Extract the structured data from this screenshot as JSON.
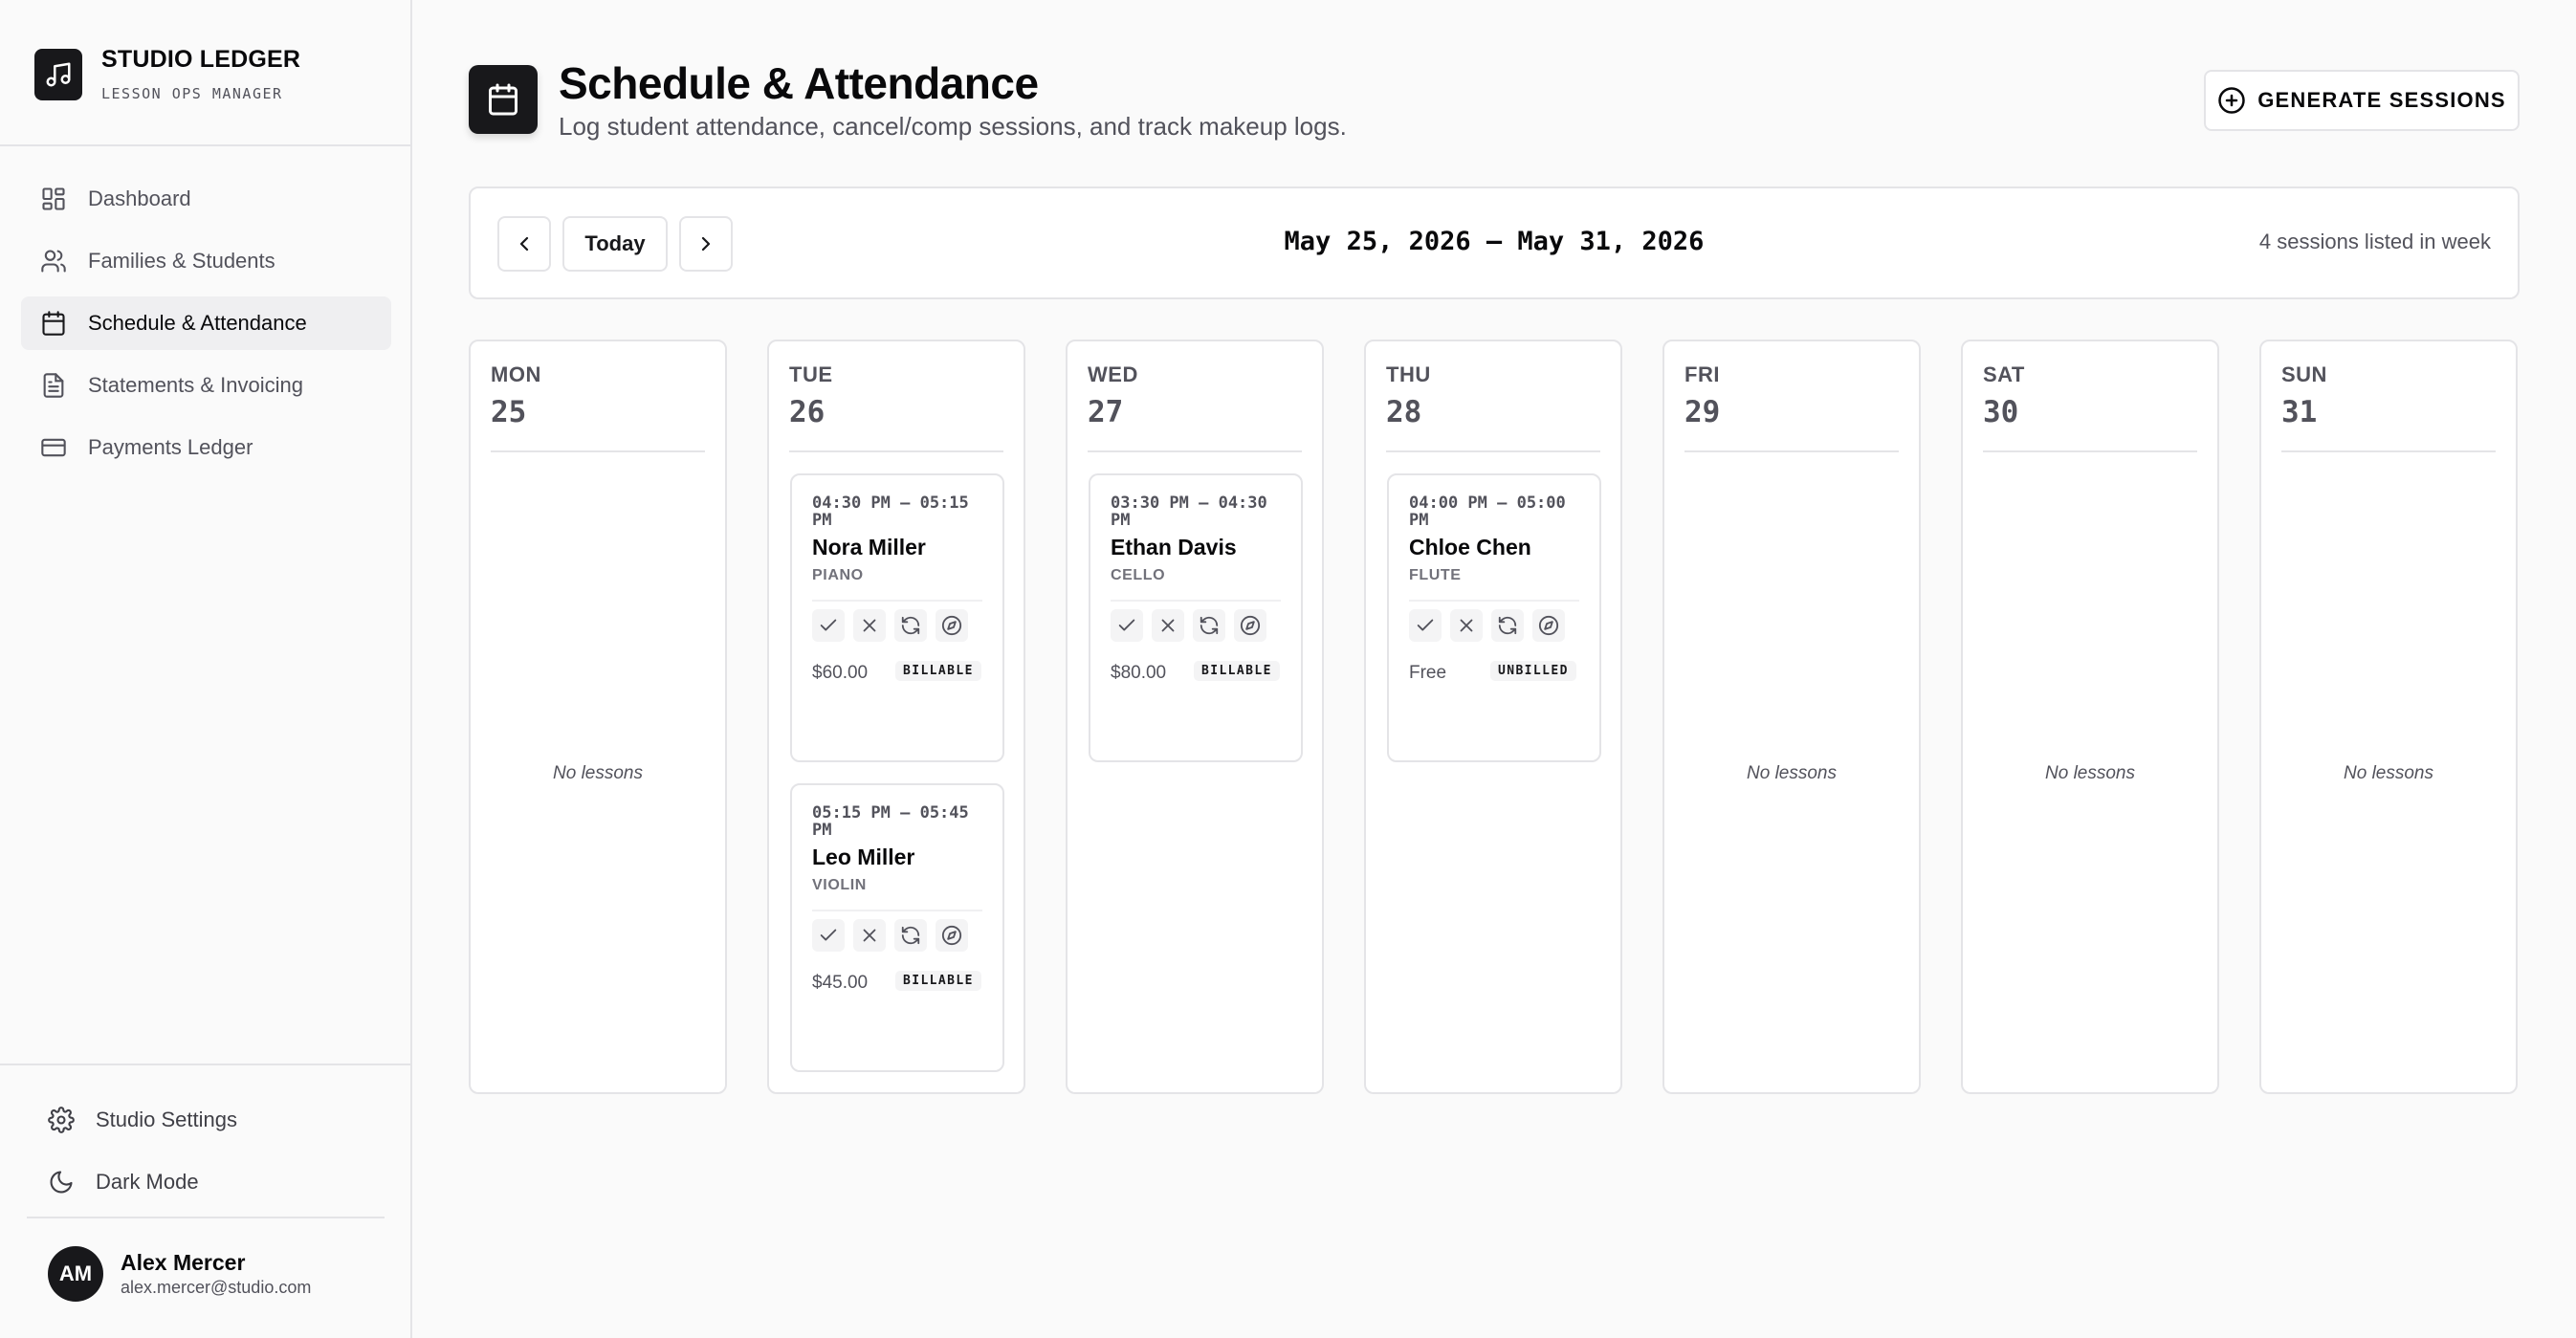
{
  "brand": {
    "title": "STUDIO LEDGER",
    "subtitle": "LESSON OPS MANAGER",
    "logo_icon": "music-note-icon"
  },
  "nav": [
    {
      "label": "Dashboard",
      "icon": "dashboard-icon",
      "active": false
    },
    {
      "label": "Families & Students",
      "icon": "users-icon",
      "active": false
    },
    {
      "label": "Schedule & Attendance",
      "icon": "calendar-icon",
      "active": true
    },
    {
      "label": "Statements & Invoicing",
      "icon": "document-icon",
      "active": false
    },
    {
      "label": "Payments Ledger",
      "icon": "credit-card-icon",
      "active": false
    }
  ],
  "bottom_nav": [
    {
      "label": "Studio Settings",
      "icon": "gear-icon"
    },
    {
      "label": "Dark Mode",
      "icon": "moon-icon"
    }
  ],
  "user": {
    "initials": "AM",
    "name": "Alex Mercer",
    "email": "alex.mercer@studio.com"
  },
  "header": {
    "title": "Schedule & Attendance",
    "subtitle": "Log student attendance, cancel/comp sessions, and track makeup logs.",
    "generate_label": "GENERATE SESSIONS"
  },
  "week": {
    "today_label": "Today",
    "range": "May 25, 2026 – May 31, 2026",
    "count_text": "4 sessions listed in week"
  },
  "empty_label": "No lessons",
  "days": [
    {
      "name": "MON",
      "num": "25"
    },
    {
      "name": "TUE",
      "num": "26"
    },
    {
      "name": "WED",
      "num": "27"
    },
    {
      "name": "THU",
      "num": "28"
    },
    {
      "name": "FRI",
      "num": "29"
    },
    {
      "name": "SAT",
      "num": "30"
    },
    {
      "name": "SUN",
      "num": "31"
    }
  ],
  "lessons": {
    "tue_1": {
      "time": "04:30 PM – 05:15 PM",
      "student": "Nora Miller",
      "instrument": "PIANO",
      "price": "$60.00",
      "status": "BILLABLE"
    },
    "tue_2": {
      "time": "05:15 PM – 05:45 PM",
      "student": "Leo Miller",
      "instrument": "VIOLIN",
      "price": "$45.00",
      "status": "BILLABLE"
    },
    "wed_1": {
      "time": "03:30 PM – 04:30 PM",
      "student": "Ethan Davis",
      "instrument": "CELLO",
      "price": "$80.00",
      "status": "BILLABLE"
    },
    "thu_1": {
      "time": "04:00 PM – 05:00 PM",
      "student": "Chloe Chen",
      "instrument": "FLUTE",
      "price": "Free",
      "status": "UNBILLED"
    }
  },
  "lesson_actions": [
    "check-icon",
    "x-icon",
    "refresh-icon",
    "compass-icon"
  ],
  "colors": {
    "accent": "#18181b",
    "border": "#e4e4e7",
    "muted_text": "#52525b",
    "active_nav_bg": "#efeff1"
  }
}
